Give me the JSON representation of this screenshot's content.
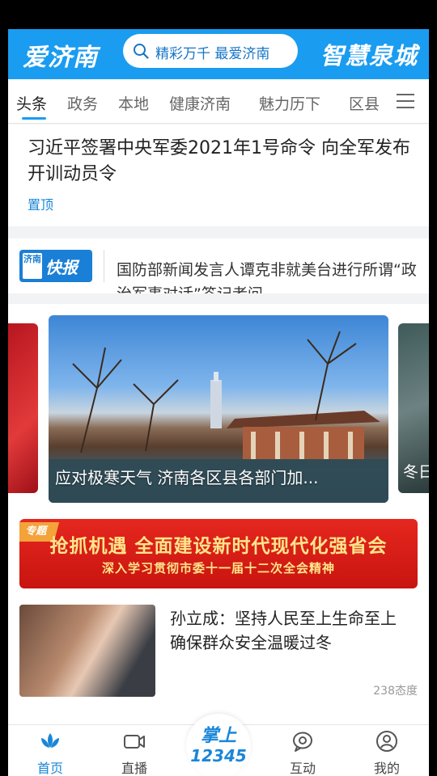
{
  "header": {
    "logo": "爱济南",
    "search_placeholder": "精彩万千 最爱济南",
    "brand_right": "智慧泉城"
  },
  "tabs": [
    {
      "label": "头条"
    },
    {
      "label": "政务"
    },
    {
      "label": "本地"
    },
    {
      "label": "健康济南"
    },
    {
      "label": "魅力历下"
    },
    {
      "label": "区县"
    }
  ],
  "pinned": {
    "title": "习近平签署中央军委2021年1号命令 向全军发布开训动员令",
    "tag": "置顶"
  },
  "flash": {
    "logo_small": "济南",
    "logo_text": "快报",
    "text": "国防部新闻发言人谭克非就美台进行所谓“政治军事对话”答记者问"
  },
  "carousel": {
    "main_caption": "应对极寒天气 济南各区县各部门加...",
    "right_caption": "冬日"
  },
  "banner": {
    "ribbon": "专题",
    "title": "抢抓机遇 全面建设新时代现代化强省会",
    "subtitle": "深入学习贯彻市委十一届十二次全会精神"
  },
  "news": {
    "title": "孙立成：坚持人民至上生命至上 确保群众安全温暖过冬",
    "meta": "238态度"
  },
  "bottom_nav": {
    "home": "首页",
    "live": "直播",
    "center_top": "掌上",
    "center_num": "12345",
    "interact": "互动",
    "mine": "我的"
  },
  "colors": {
    "brand_blue": "#1a9cf0",
    "banner_red": "#e5271f",
    "banner_text": "#ffe58a"
  }
}
